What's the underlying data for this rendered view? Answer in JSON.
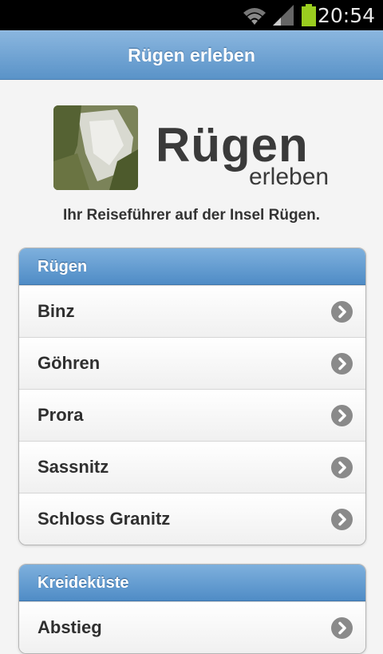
{
  "status_bar": {
    "time": "20:54",
    "icons": [
      "wifi-icon",
      "signal-icon",
      "battery-icon"
    ]
  },
  "header": {
    "title": "Rügen erleben"
  },
  "logo": {
    "word": "Rügen",
    "sub": "erleben"
  },
  "tagline": "Ihr Reiseführer auf der Insel Rügen.",
  "groups": [
    {
      "title": "Rügen",
      "items": [
        "Binz",
        "Göhren",
        "Prora",
        "Sassnitz",
        "Schloss Granitz"
      ]
    },
    {
      "title": "Kreideküste",
      "items": [
        "Abstieg"
      ]
    }
  ],
  "colors": {
    "header": "#5a93c8",
    "accent": "#4f8cc6",
    "chevron": "#8a8a8a"
  }
}
